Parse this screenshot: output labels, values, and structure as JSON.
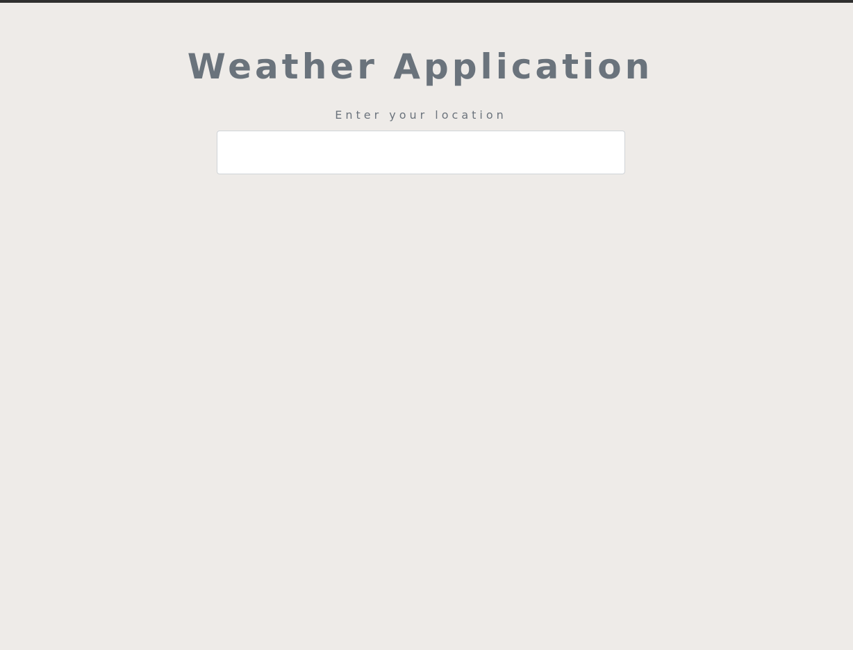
{
  "app": {
    "title": "Weather Application"
  },
  "search": {
    "label": "Enter your location",
    "value": "",
    "placeholder": ""
  },
  "colors": {
    "background": "#eeebe8",
    "title_text": "#6a737c",
    "label_text": "#6b737c",
    "input_background": "#ffffff",
    "input_border": "#cfd3d7",
    "top_border": "#2f2f2f"
  }
}
